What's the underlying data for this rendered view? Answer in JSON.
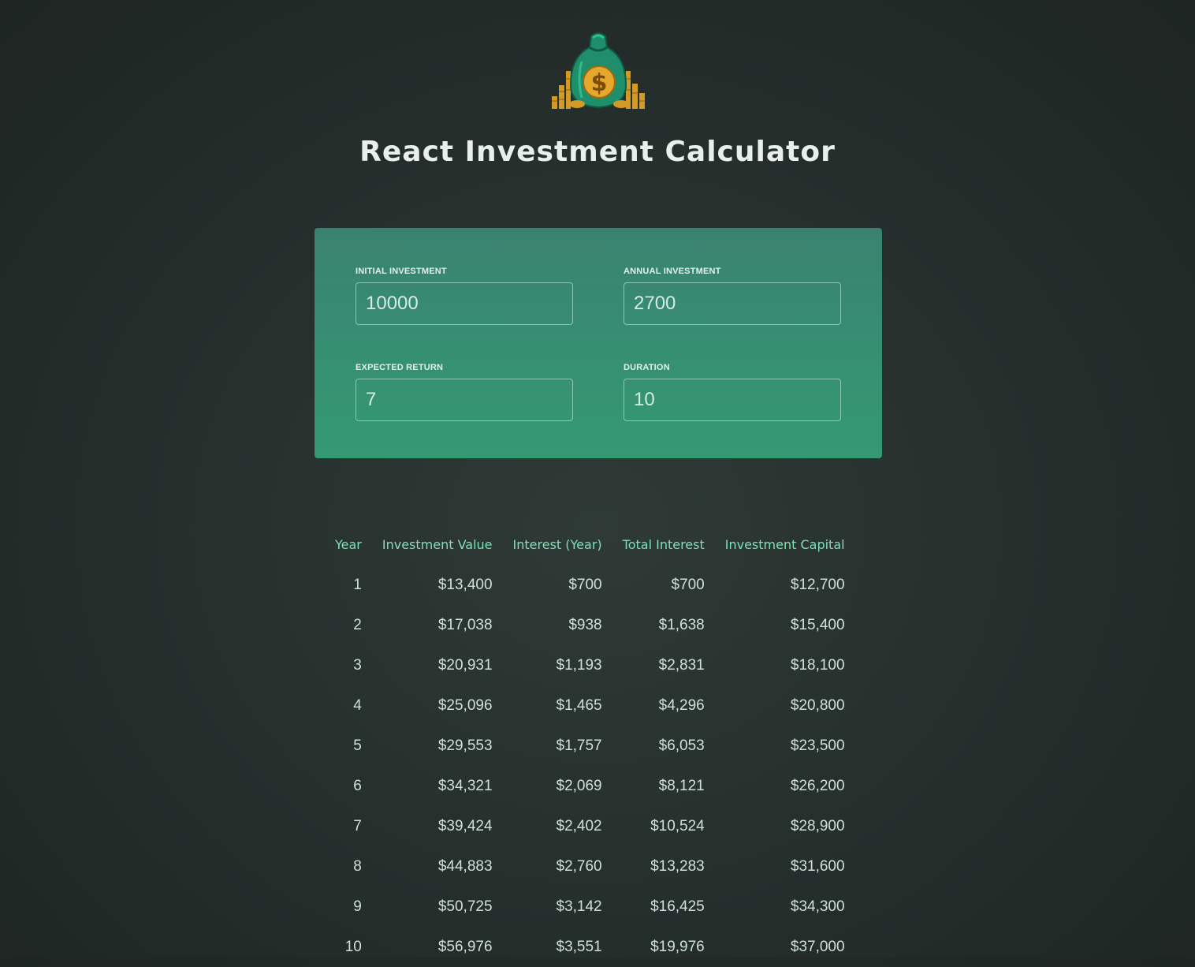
{
  "header": {
    "logo_name": "money-bag-logo",
    "title": "React Investment Calculator"
  },
  "inputs": [
    {
      "label": "INITIAL INVESTMENT",
      "value": "10000"
    },
    {
      "label": "ANNUAL INVESTMENT",
      "value": "2700"
    },
    {
      "label": "EXPECTED RETURN",
      "value": "7"
    },
    {
      "label": "DURATION",
      "value": "10"
    }
  ],
  "table": {
    "headers": [
      "Year",
      "Investment Value",
      "Interest (Year)",
      "Total Interest",
      "Investment Capital"
    ],
    "rows": [
      [
        "1",
        "$13,400",
        "$700",
        "$700",
        "$12,700"
      ],
      [
        "2",
        "$17,038",
        "$938",
        "$1,638",
        "$15,400"
      ],
      [
        "3",
        "$20,931",
        "$1,193",
        "$2,831",
        "$18,100"
      ],
      [
        "4",
        "$25,096",
        "$1,465",
        "$4,296",
        "$20,800"
      ],
      [
        "5",
        "$29,553",
        "$1,757",
        "$6,053",
        "$23,500"
      ],
      [
        "6",
        "$34,321",
        "$2,069",
        "$8,121",
        "$26,200"
      ],
      [
        "7",
        "$39,424",
        "$2,402",
        "$10,524",
        "$28,900"
      ],
      [
        "8",
        "$44,883",
        "$2,760",
        "$13,283",
        "$31,600"
      ],
      [
        "9",
        "$50,725",
        "$3,142",
        "$16,425",
        "$34,300"
      ],
      [
        "10",
        "$56,976",
        "$3,551",
        "$19,976",
        "$37,000"
      ]
    ]
  },
  "colors": {
    "background": "#262f2c",
    "panel_top": "#3a8270",
    "panel_bottom": "#349a73",
    "header_text": "#7fe0b7",
    "coin_gold": "#e0a52a"
  }
}
